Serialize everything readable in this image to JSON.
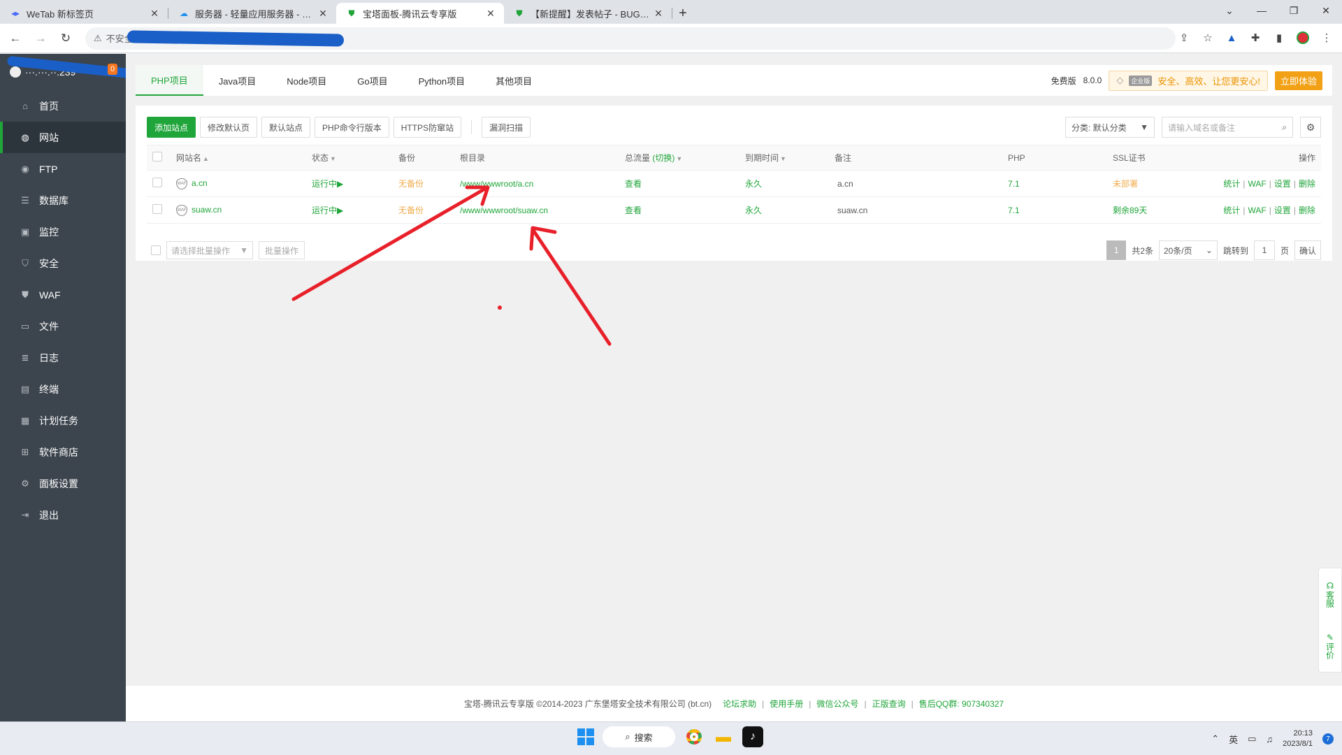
{
  "browser": {
    "tabs": [
      {
        "title": "WeTab 新标签页",
        "icon": "wetab-icon",
        "active": false
      },
      {
        "title": "服务器 - 轻量应用服务器 - 控制台",
        "icon": "cloud-icon",
        "active": false
      },
      {
        "title": "宝塔面板-腾讯云专享版",
        "icon": "bt-shield-icon",
        "active": true
      },
      {
        "title": "【新提醒】发表帖子 - BUG提交",
        "icon": "bt-shield-icon",
        "active": false
      }
    ],
    "address": "不安全"
  },
  "sidebar": {
    "server_ip": "···.···.··.239",
    "badge": "0",
    "items": [
      {
        "label": "首页",
        "icon": "home-icon"
      },
      {
        "label": "网站",
        "icon": "globe-icon"
      },
      {
        "label": "FTP",
        "icon": "ftp-icon"
      },
      {
        "label": "数据库",
        "icon": "database-icon"
      },
      {
        "label": "监控",
        "icon": "monitor-icon"
      },
      {
        "label": "安全",
        "icon": "shield-icon"
      },
      {
        "label": "WAF",
        "icon": "waf-icon"
      },
      {
        "label": "文件",
        "icon": "folder-icon"
      },
      {
        "label": "日志",
        "icon": "log-icon"
      },
      {
        "label": "终端",
        "icon": "terminal-icon"
      },
      {
        "label": "计划任务",
        "icon": "calendar-icon"
      },
      {
        "label": "软件商店",
        "icon": "grid-icon"
      },
      {
        "label": "面板设置",
        "icon": "settings-icon"
      },
      {
        "label": "退出",
        "icon": "logout-icon"
      }
    ]
  },
  "topnav": {
    "tabs": [
      "PHP项目",
      "Java项目",
      "Node项目",
      "Go项目",
      "Python项目",
      "其他项目"
    ],
    "edition": "免费版",
    "version": "8.0.0",
    "enterprise_tag": "企业版",
    "promo": "安全、高效、让您更安心!",
    "try_btn": "立即体验"
  },
  "toolbar": {
    "buttons": [
      "添加站点",
      "修改默认页",
      "默认站点",
      "PHP命令行版本",
      "HTTPS防窜站",
      "漏洞扫描"
    ],
    "category": "分类: 默认分类",
    "search_placeholder": "请输入域名或备注"
  },
  "table": {
    "headers": {
      "name": "网站名",
      "status": "状态",
      "backup": "备份",
      "root": "根目录",
      "traffic": "总流量",
      "traffic_switch": "(切换)",
      "expire": "到期时间",
      "remark": "备注",
      "php": "PHP",
      "ssl": "SSL证书",
      "ops": "操作"
    },
    "rows": [
      {
        "name": "a.cn",
        "status": "运行中",
        "backup": "无备份",
        "root": "/www/wwwroot/a.cn",
        "traffic": "查看",
        "expire": "永久",
        "remark": "a.cn",
        "php": "7.1",
        "ssl": "未部署"
      },
      {
        "name": "suaw.cn",
        "status": "运行中",
        "backup": "无备份",
        "root": "/www/wwwroot/suaw.cn",
        "traffic": "查看",
        "expire": "永久",
        "remark": "suaw.cn",
        "php": "7.1",
        "ssl": "剩余89天"
      }
    ],
    "ops": [
      "统计",
      "WAF",
      "设置",
      "删除"
    ]
  },
  "batch": {
    "select_placeholder": "请选择批量操作",
    "button": "批量操作"
  },
  "pager": {
    "current": "1",
    "total": "共2条",
    "per_page": "20条/页",
    "jump_label": "跳转到",
    "jump_value": "1",
    "page_unit": "页",
    "confirm": "确认"
  },
  "footer": {
    "copyright": "宝塔-腾讯云专享版 ©2014-2023 广东堡塔安全技术有限公司 (bt.cn)",
    "links": [
      "论坛求助",
      "使用手册",
      "微信公众号",
      "正版查询",
      "售后QQ群: 907340327"
    ]
  },
  "sidebtns": [
    "客服",
    "评价"
  ],
  "taskbar": {
    "search": "搜索",
    "ime": "英",
    "time": "20:13",
    "date": "2023/8/1",
    "notifications": "7"
  },
  "colors": {
    "accent": "#20a53a",
    "sidebar": "#3c444d",
    "warning": "#f0ad4e",
    "annotation": "#e8202a"
  }
}
